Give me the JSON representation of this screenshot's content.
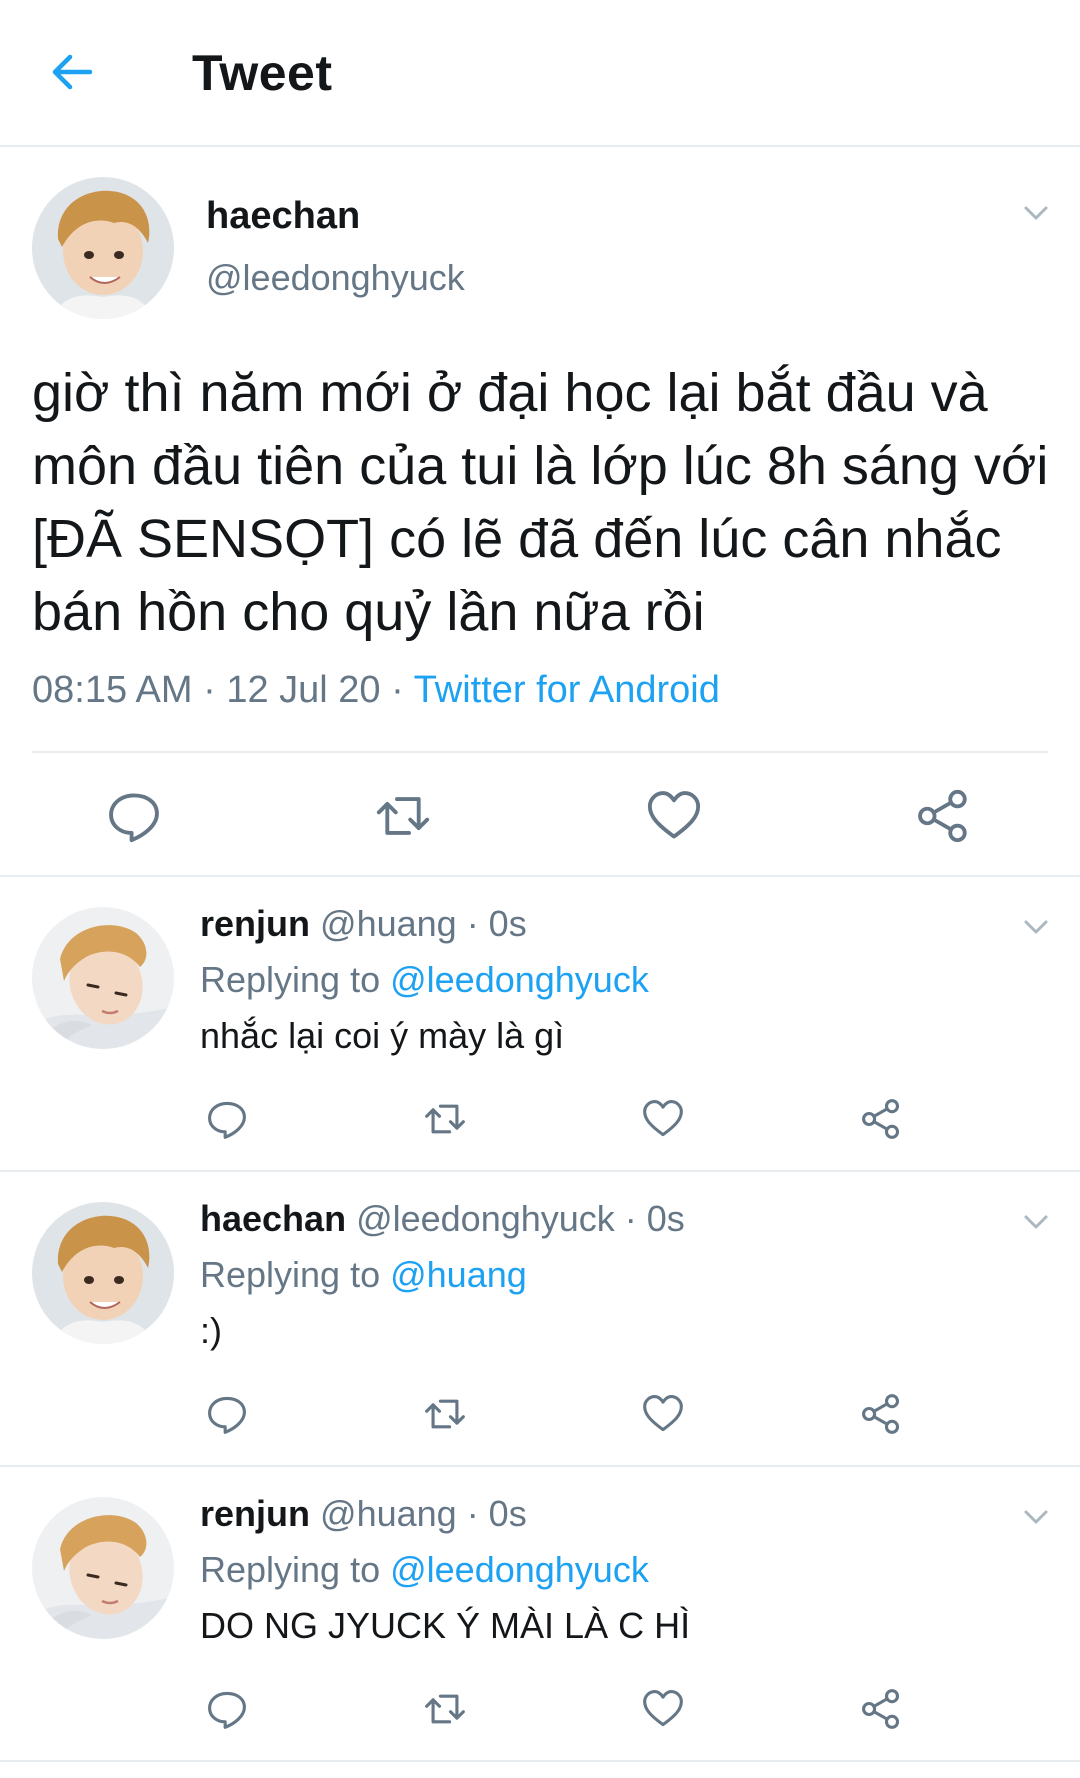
{
  "header": {
    "title": "Tweet"
  },
  "main_tweet": {
    "name": "haechan",
    "handle": "@leedonghyuck",
    "text": "giờ thì năm mới ở đại học lại bắt đầu và môn đầu tiên của tui là lớp lúc 8h sáng với [ĐÃ SENSỌT] có lẽ đã đến lúc cân nhắc bán hồn cho quỷ lần nữa rồi",
    "timestamp": "08:15 AM · 12 Jul 20 · ",
    "source": "Twitter for Android"
  },
  "replies": [
    {
      "name": "renjun",
      "handle": "@huang",
      "time": " · 0s",
      "replying_prefix": "Replying to ",
      "replying_to": "@leedonghyuck",
      "text": "nhắc lại coi ý mày là gì"
    },
    {
      "name": "haechan",
      "handle": "@leedonghyuck",
      "time": " · 0s",
      "replying_prefix": "Replying to ",
      "replying_to": "@huang",
      "text": ":)"
    },
    {
      "name": "renjun",
      "handle": "@huang",
      "time": " · 0s",
      "replying_prefix": "Replying to ",
      "replying_to": "@leedonghyuck",
      "text": "DO NG JYUCK Ý MÀI LÀ C HÌ"
    }
  ],
  "icons": {
    "back": "back-arrow-icon",
    "menu": "chevron-down-icon",
    "reply": "reply-icon",
    "retweet": "retweet-icon",
    "like": "heart-icon",
    "share": "share-icon"
  },
  "colors": {
    "accent": "#1da1f2",
    "secondary_text": "#657786",
    "primary_text": "#14171a",
    "divider": "#e6ecf0"
  }
}
